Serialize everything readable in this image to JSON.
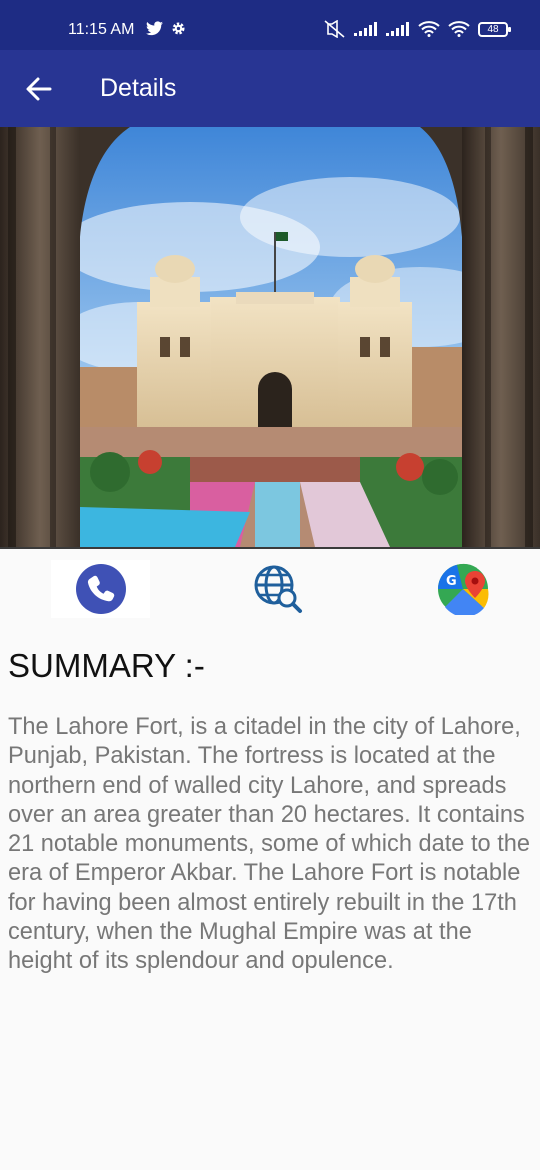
{
  "status_bar": {
    "time": "11:15 AM",
    "battery": "48",
    "icons": [
      "twitter-icon",
      "gear-icon",
      "mute-icon",
      "signal-icon",
      "signal-icon",
      "wifi-icon",
      "wifi-icon",
      "battery-icon"
    ]
  },
  "app_bar": {
    "title": "Details",
    "back_icon": "arrow-left-icon"
  },
  "hero_image": {
    "subject": "Lahore Fort photo"
  },
  "actions": [
    {
      "name": "call",
      "icon": "phone-icon",
      "color": "#3f51b5"
    },
    {
      "name": "website",
      "icon": "globe-search-icon",
      "color": "#1f5f9c"
    },
    {
      "name": "maps",
      "icon": "google-maps-icon",
      "color": "#34a853"
    }
  ],
  "summary": {
    "title": "SUMMARY :-",
    "body": "The Lahore Fort, is a citadel in the city of Lahore, Punjab, Pakistan. The fortress is located at the northern end of walled city Lahore, and spreads over an area greater than 20 hectares. It contains 21 notable monuments, some of which date to the era of Emperor Akbar. The Lahore Fort is notable for having been almost entirely rebuilt in the 17th century, when the Mughal Empire was at the height of its splendour and opulence."
  },
  "colors": {
    "status_bar": "#1e2c84",
    "app_bar": "#283593",
    "background": "#fafafa",
    "summary_text": "#777777"
  }
}
